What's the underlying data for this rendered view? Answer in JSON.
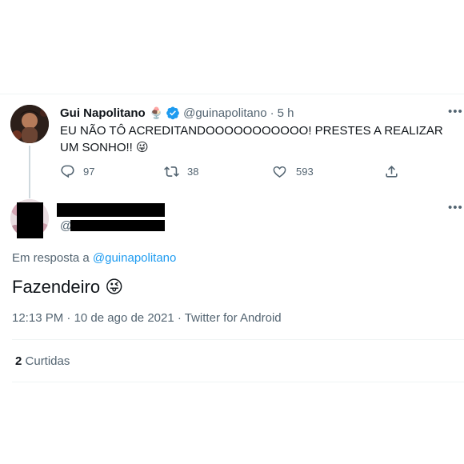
{
  "original_tweet": {
    "author_name": "Gui Napolitano",
    "handle": "@guinapolitano",
    "separator": "·",
    "time": "5 h",
    "text": "EU NÃO TÔ ACREDITANDOOOOOOOOOOO! PRESTES A REALIZAR UM SONHO!!",
    "emoji": "😜",
    "badge_emoji": "🍨",
    "stats": {
      "replies": "97",
      "retweets": "38",
      "likes": "593"
    }
  },
  "reply_tweet": {
    "handle_prefix": "@",
    "in_reply_label": "Em resposta a",
    "in_reply_handle": "@guinapolitano",
    "text": "Fazendeiro",
    "emoji": "😜",
    "meta": {
      "time": "12:13 PM",
      "date": "10 de ago de 2021",
      "source": "Twitter for Android",
      "separator": "·"
    },
    "likes_count": "2",
    "likes_label": "Curtidas"
  },
  "colors": {
    "verified_blue": "#1d9bf0",
    "link_blue": "#1d9bf0",
    "secondary_text": "#536471",
    "divider": "#eff3f4"
  },
  "icons": [
    "more-options-icon",
    "verified-badge-icon",
    "reply-icon",
    "retweet-icon",
    "like-icon",
    "share-icon"
  ]
}
